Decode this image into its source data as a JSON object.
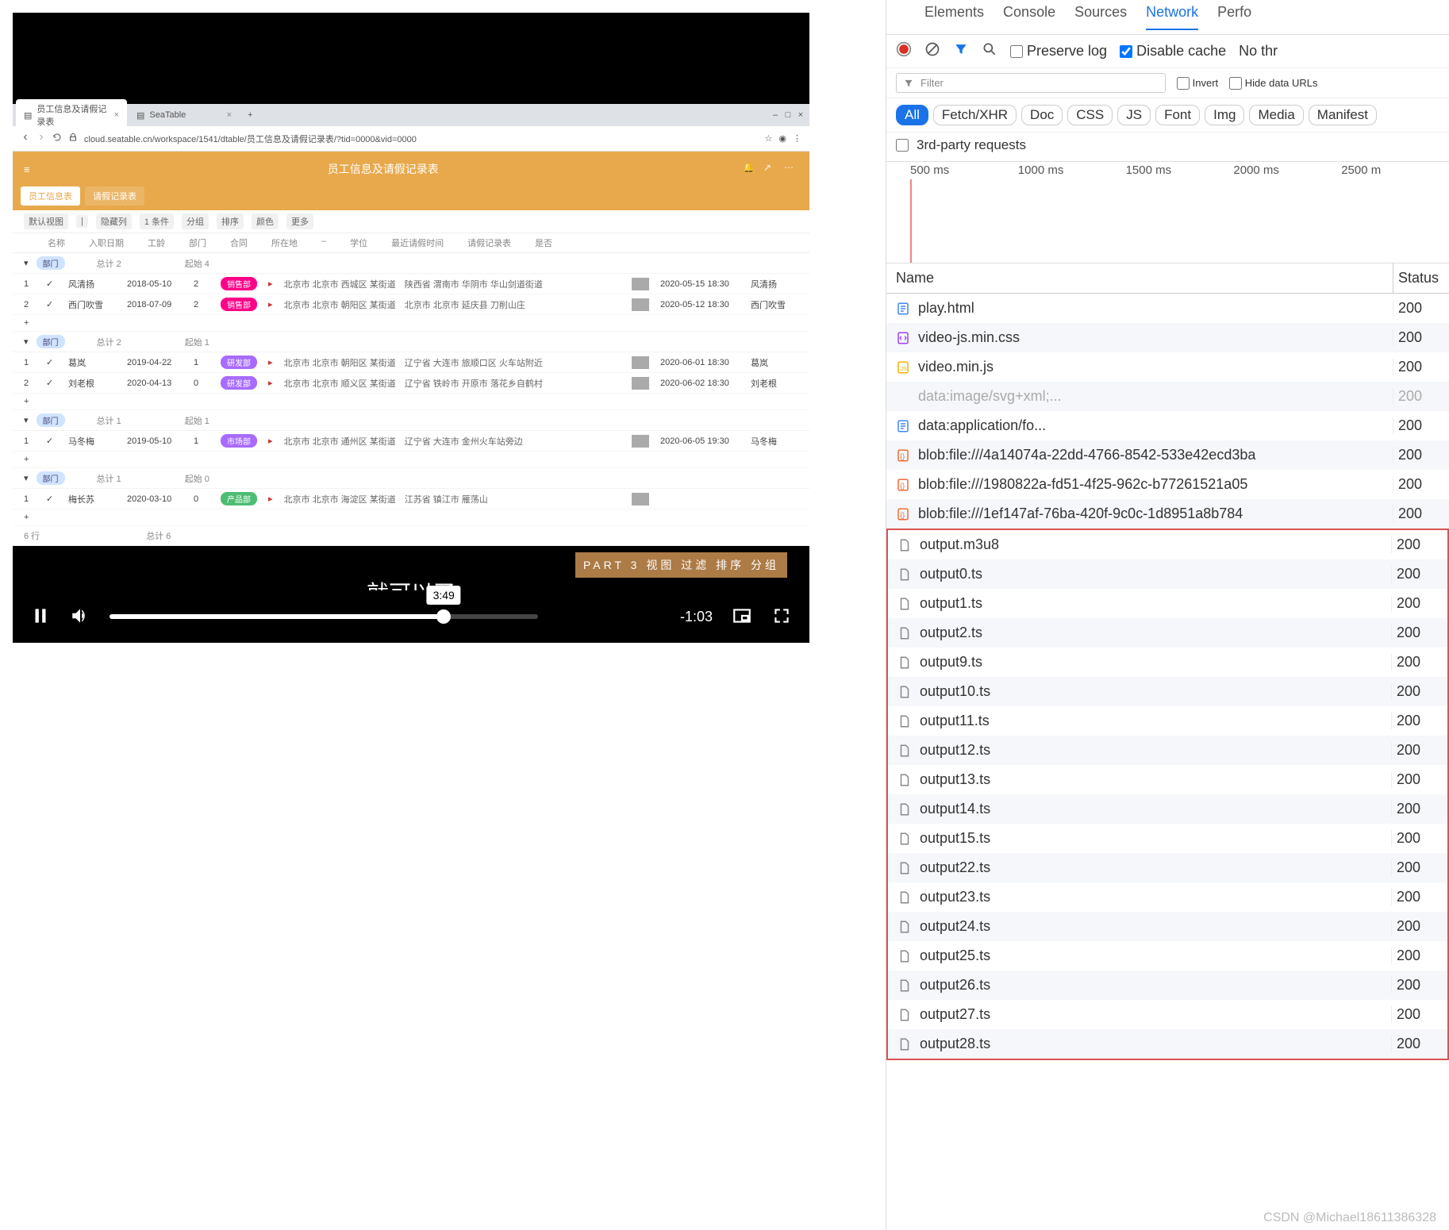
{
  "video": {
    "browser": {
      "tabs": [
        {
          "title": "员工信息及请假记录表",
          "active": true
        },
        {
          "title": "SeaTable",
          "active": false
        }
      ],
      "url": "cloud.seatable.cn/workspace/1541/dtable/员工信息及请假记录表/?tid=0000&vid=0000",
      "win_min": "–",
      "win_max": "□",
      "win_close": "×"
    },
    "app": {
      "title": "员工信息及请假记录表",
      "sub_tabs": [
        {
          "label": "员工信息表",
          "active": true
        },
        {
          "label": "请假记录表",
          "active": false
        }
      ]
    },
    "toolbar": {
      "items": [
        "默认视图",
        "|",
        "隐藏列",
        "1 条件",
        "分组",
        "排序",
        "颜色",
        "更多"
      ]
    },
    "columns": [
      "",
      "名称",
      "入职日期",
      "工龄",
      "部门",
      "合同",
      "所在地",
      "–",
      "学位",
      "最近请假时间",
      "请假记录表",
      "是否"
    ],
    "groups": [
      {
        "pill": "部门",
        "pill_color": "b-orange",
        "summary": [
          "总计 2",
          "",
          "起始 4"
        ],
        "rows": [
          {
            "idx": "1",
            "name": "风清扬",
            "date": "2018-05-10",
            "work": "2",
            "dept": "销售部",
            "dept_cls": "b-red",
            "addr": "北京市 北京市 西城区 某街道　陕西省 渭南市 华阴市 华山剑道街道",
            "dt": "2020-05-15 18:30",
            "rec": "风清扬"
          },
          {
            "idx": "2",
            "name": "西门吹雪",
            "date": "2018-07-09",
            "work": "2",
            "dept": "销售部",
            "dept_cls": "b-red",
            "addr": "北京市 北京市 朝阳区 某街道　北京市 北京市 延庆县 刀削山庄",
            "dt": "2020-05-12 18:30",
            "rec": "西门吹雪"
          }
        ]
      },
      {
        "pill": "部门",
        "pill_color": "b-violet",
        "summary": [
          "总计 2",
          "",
          "起始 1"
        ],
        "rows": [
          {
            "idx": "1",
            "name": "葛岚",
            "date": "2019-04-22",
            "work": "1",
            "dept": "研发部",
            "dept_cls": "b-violet",
            "addr": "北京市 北京市 朝阳区 某街道　辽宁省 大连市 旅顺口区 火车站附近",
            "dt": "2020-06-01 18:30",
            "rec": "葛岚"
          },
          {
            "idx": "2",
            "name": "刘老根",
            "date": "2020-04-13",
            "work": "0",
            "dept": "研发部",
            "dept_cls": "b-violet",
            "addr": "北京市 北京市 顺义区 某街道　辽宁省 铁岭市 开原市 落花乡自鹤村",
            "dt": "2020-06-02 18:30",
            "rec": "刘老根"
          }
        ]
      },
      {
        "pill": "部门",
        "pill_color": "b-violet",
        "summary": [
          "总计 1",
          "",
          "起始 1"
        ],
        "rows": [
          {
            "idx": "1",
            "name": "马冬梅",
            "date": "2019-05-10",
            "work": "1",
            "dept": "市场部",
            "dept_cls": "b-violet",
            "addr": "北京市 北京市 通州区 某街道　辽宁省 大连市 金州火车站旁边",
            "dt": "2020-06-05 19:30",
            "rec": "马冬梅"
          }
        ]
      },
      {
        "pill": "部门",
        "pill_color": "b-green",
        "summary": [
          "总计 1",
          "",
          "起始 0"
        ],
        "rows": [
          {
            "idx": "1",
            "name": "梅长苏",
            "date": "2020-03-10",
            "work": "0",
            "dept": "产品部",
            "dept_cls": "b-green",
            "addr": "北京市 北京市 海淀区 某街道　江苏省 镇江市 雁荡山",
            "dt": "",
            "rec": ""
          }
        ]
      }
    ],
    "footer": {
      "label": "6 行",
      "summary": "总计 6"
    },
    "caption": "就可以了",
    "banner": "PART 3 视图 过滤 排序 分组",
    "controls": {
      "tip": "3:49",
      "remaining": "-1:03"
    }
  },
  "devtools": {
    "tabs": [
      "Elements",
      "Console",
      "Sources",
      "Network",
      "Perfo"
    ],
    "active_tab": "Network",
    "row2": {
      "preserve": "Preserve log",
      "disable": "Disable cache",
      "disable_checked": true,
      "throttle": "No thr"
    },
    "filter_placeholder": "Filter",
    "invert": "Invert",
    "hide": "Hide data URLs",
    "types": [
      "All",
      "Fetch/XHR",
      "Doc",
      "CSS",
      "JS",
      "Font",
      "Img",
      "Media",
      "Manifest"
    ],
    "types_active": "All",
    "third": "3rd-party requests",
    "ticks": [
      "500 ms",
      "1000 ms",
      "1500 ms",
      "2000 ms",
      "2500 m"
    ],
    "hdr": {
      "name": "Name",
      "status": "Status"
    },
    "requests": [
      {
        "icon": "doc",
        "color": "#4285f4",
        "name": "play.html",
        "status": "200",
        "hl": false
      },
      {
        "icon": "css",
        "color": "#a142f4",
        "name": "video-js.min.css",
        "status": "200",
        "hl": false
      },
      {
        "icon": "js",
        "color": "#f4b400",
        "name": "video.min.js",
        "status": "200",
        "hl": false
      },
      {
        "icon": "blank",
        "color": "#999",
        "name": "data:image/svg+xml;...",
        "status": "200",
        "hl": false,
        "muted": true
      },
      {
        "icon": "doc",
        "color": "#4285f4",
        "name": "data:application/fo...",
        "status": "200",
        "hl": false
      },
      {
        "icon": "brace",
        "color": "#f26b3a",
        "name": "blob:file:///4a14074a-22dd-4766-8542-533e42ecd3ba",
        "status": "200",
        "hl": false
      },
      {
        "icon": "brace",
        "color": "#f26b3a",
        "name": "blob:file:///1980822a-fd51-4f25-962c-b77261521a05",
        "status": "200",
        "hl": false
      },
      {
        "icon": "brace",
        "color": "#f26b3a",
        "name": "blob:file:///1ef147af-76ba-420f-9c0c-1d8951a8b784",
        "status": "200",
        "hl": false
      },
      {
        "icon": "file",
        "color": "#888",
        "name": "output.m3u8",
        "status": "200",
        "hl": true
      },
      {
        "icon": "file",
        "color": "#888",
        "name": "output0.ts",
        "status": "200",
        "hl": true
      },
      {
        "icon": "file",
        "color": "#888",
        "name": "output1.ts",
        "status": "200",
        "hl": true
      },
      {
        "icon": "file",
        "color": "#888",
        "name": "output2.ts",
        "status": "200",
        "hl": true
      },
      {
        "icon": "file",
        "color": "#888",
        "name": "output9.ts",
        "status": "200",
        "hl": true
      },
      {
        "icon": "file",
        "color": "#888",
        "name": "output10.ts",
        "status": "200",
        "hl": true
      },
      {
        "icon": "file",
        "color": "#888",
        "name": "output11.ts",
        "status": "200",
        "hl": true
      },
      {
        "icon": "file",
        "color": "#888",
        "name": "output12.ts",
        "status": "200",
        "hl": true
      },
      {
        "icon": "file",
        "color": "#888",
        "name": "output13.ts",
        "status": "200",
        "hl": true
      },
      {
        "icon": "file",
        "color": "#888",
        "name": "output14.ts",
        "status": "200",
        "hl": true
      },
      {
        "icon": "file",
        "color": "#888",
        "name": "output15.ts",
        "status": "200",
        "hl": true
      },
      {
        "icon": "file",
        "color": "#888",
        "name": "output22.ts",
        "status": "200",
        "hl": true
      },
      {
        "icon": "file",
        "color": "#888",
        "name": "output23.ts",
        "status": "200",
        "hl": true
      },
      {
        "icon": "file",
        "color": "#888",
        "name": "output24.ts",
        "status": "200",
        "hl": true
      },
      {
        "icon": "file",
        "color": "#888",
        "name": "output25.ts",
        "status": "200",
        "hl": true
      },
      {
        "icon": "file",
        "color": "#888",
        "name": "output26.ts",
        "status": "200",
        "hl": true
      },
      {
        "icon": "file",
        "color": "#888",
        "name": "output27.ts",
        "status": "200",
        "hl": true
      },
      {
        "icon": "file",
        "color": "#888",
        "name": "output28.ts",
        "status": "200",
        "hl": true
      }
    ]
  },
  "watermark": "CSDN @Michael18611386328"
}
